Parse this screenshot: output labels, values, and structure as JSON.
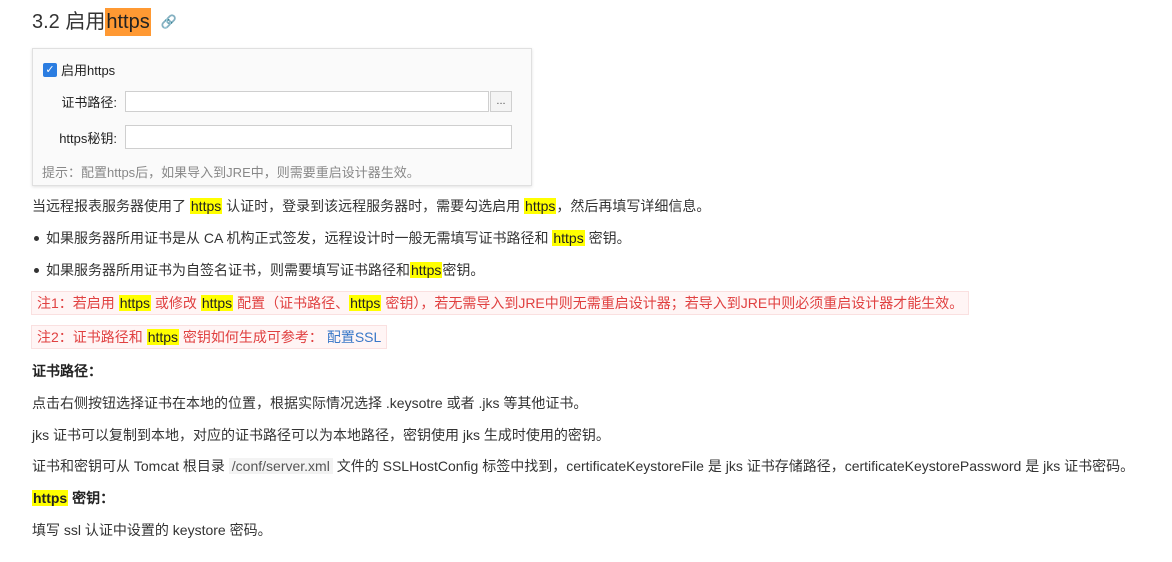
{
  "heading": {
    "prefix": "3.2 启用",
    "highlight": "https"
  },
  "panel": {
    "checkbox_label": "启用https",
    "cert_path_label": "证书路径:",
    "browse_label": "...",
    "secret_label": "https秘钥:",
    "hint": "提示：配置https后，如果导入到JRE中，则需要重启设计器生效。"
  },
  "p1": {
    "a": "当远程报表服务器使用了 ",
    "b": "https",
    "c": " 认证时，登录到该远程服务器时，需要勾选启用 ",
    "d": "https",
    "e": "，然后再填写详细信息。"
  },
  "b1": {
    "a": "如果服务器所用证书是从 CA 机构正式签发，远程设计时一般无需填写证书路径和 ",
    "b": "https",
    "c": " 密钥。"
  },
  "b2": {
    "a": "如果服务器所用证书为自签名证书，则需要填写证书路径和",
    "b": "https",
    "c": "密钥。"
  },
  "note1": {
    "a": "注1：若启用 ",
    "b": "https",
    "c": " 或修改 ",
    "d": "https",
    "e": " 配置（证书路径、",
    "f": "https",
    "g": " 密钥），若无需导入到JRE中则无需重启设计器；若导入到JRE中则必须重启设计器才能生效。"
  },
  "note2": {
    "a": "注2：证书路径和 ",
    "b": "https",
    "c": " 密钥如何生成可参考：",
    "link": "配置SSL"
  },
  "cert_heading": "证书路径：",
  "p2": "点击右侧按钮选择证书在本地的位置，根据实际情况选择 .keysotre 或者 .jks 等其他证书。",
  "p3": "jks 证书可以复制到本地，对应的证书路径可以为本地路径，密钥使用 jks 生成时使用的密钥。",
  "p4": {
    "a": "证书和密钥可从 Tomcat 根目录 ",
    "code": "/conf/server.xml",
    "b": " 文件的 SSLHostConfig 标签中找到，certificateKeystoreFile 是 jks 证书存储路径，certificateKeystorePassword 是 jks 证书密码。"
  },
  "key_heading": {
    "hl": "https",
    "rest": " 密钥："
  },
  "p5": "填写 ssl 认证中设置的 keystore 密码。",
  "icons": {
    "link": "link-icon",
    "check": "checkbox-checked-icon"
  },
  "colors": {
    "heading_highlight": "#ff9933",
    "keyword_highlight": "#ffff00",
    "note_text": "#e04040",
    "link": "#3a78c8",
    "checkbox": "#2b7de1"
  }
}
